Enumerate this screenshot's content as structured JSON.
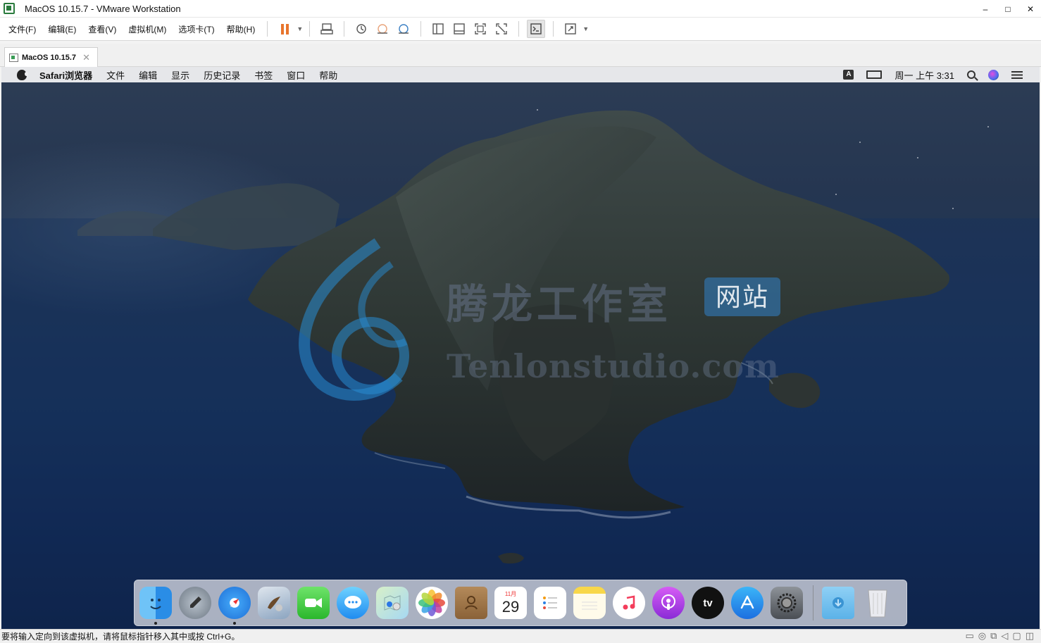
{
  "window": {
    "title": "MacOS 10.15.7 - VMware Workstation",
    "minimize": "–",
    "maximize": "□",
    "close": "✕"
  },
  "menu": [
    "文件(F)",
    "编辑(E)",
    "查看(V)",
    "虚拟机(M)",
    "选项卡(T)",
    "帮助(H)"
  ],
  "toolbar": {
    "icons": [
      "pause-icon",
      "send-ctrl-alt-del-icon",
      "snapshot-icon",
      "revert-snapshot-icon",
      "snapshot-manager-icon",
      "library-icon",
      "thumbnail-icon",
      "fullscreen-icon",
      "unity-icon",
      "console-icon",
      "stretch-icon"
    ],
    "pause_color": "#e8752d"
  },
  "tab": {
    "label": "MacOS 10.15.7",
    "close": "✕"
  },
  "mac": {
    "app_menus": [
      "Safari浏览器",
      "文件",
      "编辑",
      "显示",
      "历史记录",
      "书签",
      "窗口",
      "帮助"
    ],
    "input_indicator": "A",
    "clock": "周一 上午 3:31"
  },
  "watermark": {
    "cn": "腾龙工作室",
    "badge": "网站",
    "en": "Tenlonstudio.com"
  },
  "dock": {
    "calendar_month": "11月",
    "calendar_day": "29",
    "apps": [
      "finder-icon",
      "launchpad-icon",
      "safari-icon",
      "mail-preview-icon",
      "facetime-icon",
      "messages-icon",
      "maps-icon",
      "photos-icon",
      "contacts-icon",
      "calendar-icon",
      "reminders-icon",
      "notes-icon",
      "music-icon",
      "podcasts-icon",
      "tv-icon",
      "app-store-icon",
      "system-preferences-icon",
      "downloads-folder-icon",
      "trash-icon"
    ],
    "tv_label": "tv"
  },
  "statusbar": {
    "hint": "要将输入定向到该虚拟机，请将鼠标指针移入其中或按 Ctrl+G。"
  }
}
